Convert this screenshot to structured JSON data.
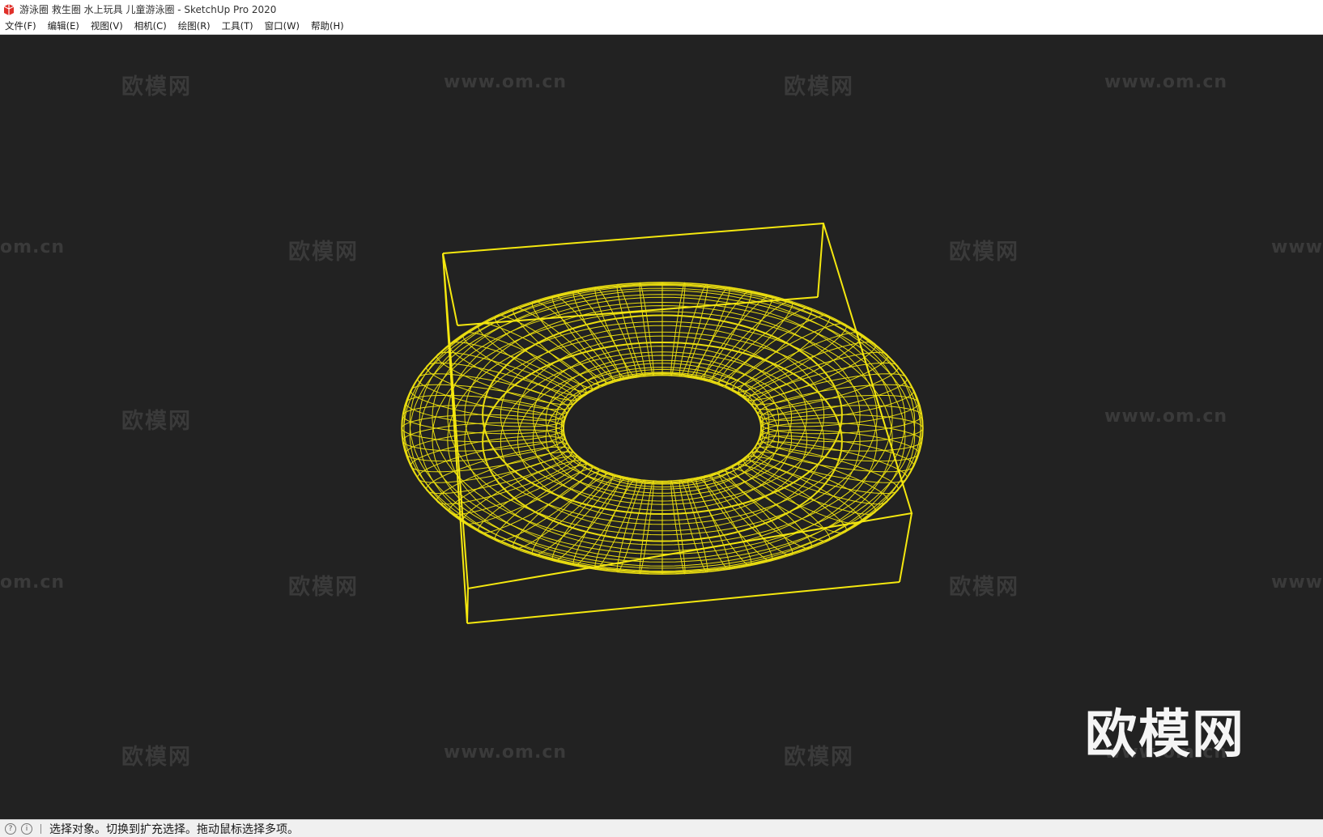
{
  "window": {
    "title": "游泳圈 救生圈 水上玩具 儿童游泳圈 - SketchUp Pro 2020",
    "app_icon": "sketchup-logo-icon",
    "accent_color": "#e0302a"
  },
  "menu": [
    {
      "id": "file",
      "label": "文件(F)"
    },
    {
      "id": "edit",
      "label": "编辑(E)"
    },
    {
      "id": "view",
      "label": "视图(V)"
    },
    {
      "id": "camera",
      "label": "相机(C)"
    },
    {
      "id": "draw",
      "label": "绘图(R)"
    },
    {
      "id": "tools",
      "label": "工具(T)"
    },
    {
      "id": "window",
      "label": "窗口(W)"
    },
    {
      "id": "help",
      "label": "帮助(H)"
    }
  ],
  "viewport": {
    "background_color": "#222222",
    "wireframe_color": "#f5e80f",
    "model": "swim-ring-wireframe",
    "watermark_cn": "欧模网",
    "watermark_url": "www.om.cn",
    "watermark_url_partial_left": "om.cn",
    "watermark_url_partial_right": "www.",
    "logo_text": "欧模网"
  },
  "status": {
    "icons": [
      "geolocation-icon",
      "credits-icon"
    ],
    "text": "选择对象。切换到扩充选择。拖动鼠标选择多项。"
  }
}
